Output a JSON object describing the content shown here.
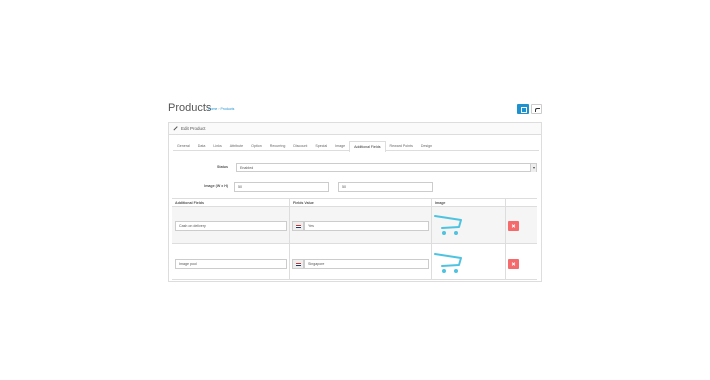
{
  "header": {
    "title": "Products",
    "breadcrumb": [
      "Home",
      "Products"
    ]
  },
  "panel": {
    "title": "Edit Product"
  },
  "tabs": [
    {
      "label": "General"
    },
    {
      "label": "Data"
    },
    {
      "label": "Links"
    },
    {
      "label": "Attribute"
    },
    {
      "label": "Option"
    },
    {
      "label": "Recurring"
    },
    {
      "label": "Discount"
    },
    {
      "label": "Special"
    },
    {
      "label": "Image"
    },
    {
      "label": "Additional Fields",
      "active": true
    },
    {
      "label": "Reward Points"
    },
    {
      "label": "Design"
    }
  ],
  "form": {
    "status_label": "Status",
    "status_value": "Enabled",
    "image_size_label": "Image (W x H)",
    "image_width": "50",
    "image_height": "50"
  },
  "table": {
    "headers": [
      "Additional Fields",
      "Fields Value",
      "Image"
    ],
    "rows": [
      {
        "field": "Cash on delivery",
        "value": "Yes"
      },
      {
        "field": "Image pool",
        "value": "Singapore"
      }
    ]
  },
  "colors": {
    "primary": "#1e91cf",
    "danger": "#f56b6b",
    "cart": "#4ec3e0"
  }
}
